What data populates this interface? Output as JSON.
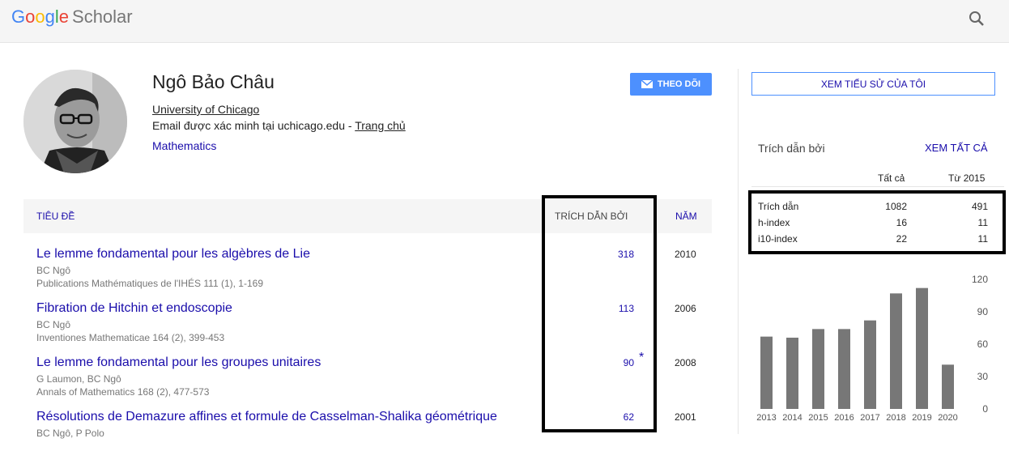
{
  "header": {
    "logo_google": [
      "G",
      "o",
      "o",
      "g",
      "l",
      "e"
    ],
    "logo_scholar": "Scholar"
  },
  "profile": {
    "name": "Ngô Bảo Châu",
    "affiliation": "University of Chicago",
    "email_text": "Email được xác minh tại uchicago.edu - ",
    "homepage_link": "Trang chủ",
    "interest": "Mathematics",
    "follow_label": "THEO DÕI"
  },
  "table": {
    "headers": {
      "title": "TIÊU ĐỀ",
      "cited_by": "TRÍCH DẪN BỞI",
      "year": "NĂM"
    },
    "rows": [
      {
        "title": "Le lemme fondamental pour les algèbres de Lie",
        "authors": "BC Ngô",
        "venue": "Publications Mathématiques de l'IHÉS 111 (1), 1-169",
        "cites": "318",
        "year": "2010",
        "star": ""
      },
      {
        "title": "Fibration de Hitchin et endoscopie",
        "authors": "BC Ngô",
        "venue": "Inventiones Mathematicae 164 (2), 399-453",
        "cites": "113",
        "year": "2006",
        "star": ""
      },
      {
        "title": "Le lemme fondamental pour les groupes unitaires",
        "authors": "G Laumon, BC Ngô",
        "venue": "Annals of Mathematics 168 (2), 477-573",
        "cites": "90",
        "year": "2008",
        "star": "*"
      },
      {
        "title": "Résolutions de Demazure affines et formule de Casselman-Shalika géométrique",
        "authors": "BC Ngô, P Polo",
        "venue": "",
        "cites": "62",
        "year": "2001",
        "star": ""
      }
    ]
  },
  "sidebar": {
    "cv_button": "XEM TIỂU SỬ CỦA TÔI",
    "cited_by": "Trích dẫn bởi",
    "view_all": "XEM TẤT CẢ",
    "col_all": "Tất cả",
    "col_since": "Từ 2015",
    "stats": [
      {
        "label": "Trích dẫn",
        "all": "1082",
        "since": "491"
      },
      {
        "label": "h-index",
        "all": "16",
        "since": "11"
      },
      {
        "label": "i10-index",
        "all": "22",
        "since": "11"
      }
    ]
  },
  "chart_data": {
    "type": "bar",
    "categories": [
      "2013",
      "2014",
      "2015",
      "2016",
      "2017",
      "2018",
      "2019",
      "2020"
    ],
    "values": [
      67,
      66,
      74,
      74,
      82,
      107,
      112,
      41
    ],
    "ylim": [
      0,
      120
    ],
    "yticks": [
      0,
      30,
      60,
      90,
      120
    ],
    "bar_color": "#777777",
    "grid": false
  }
}
